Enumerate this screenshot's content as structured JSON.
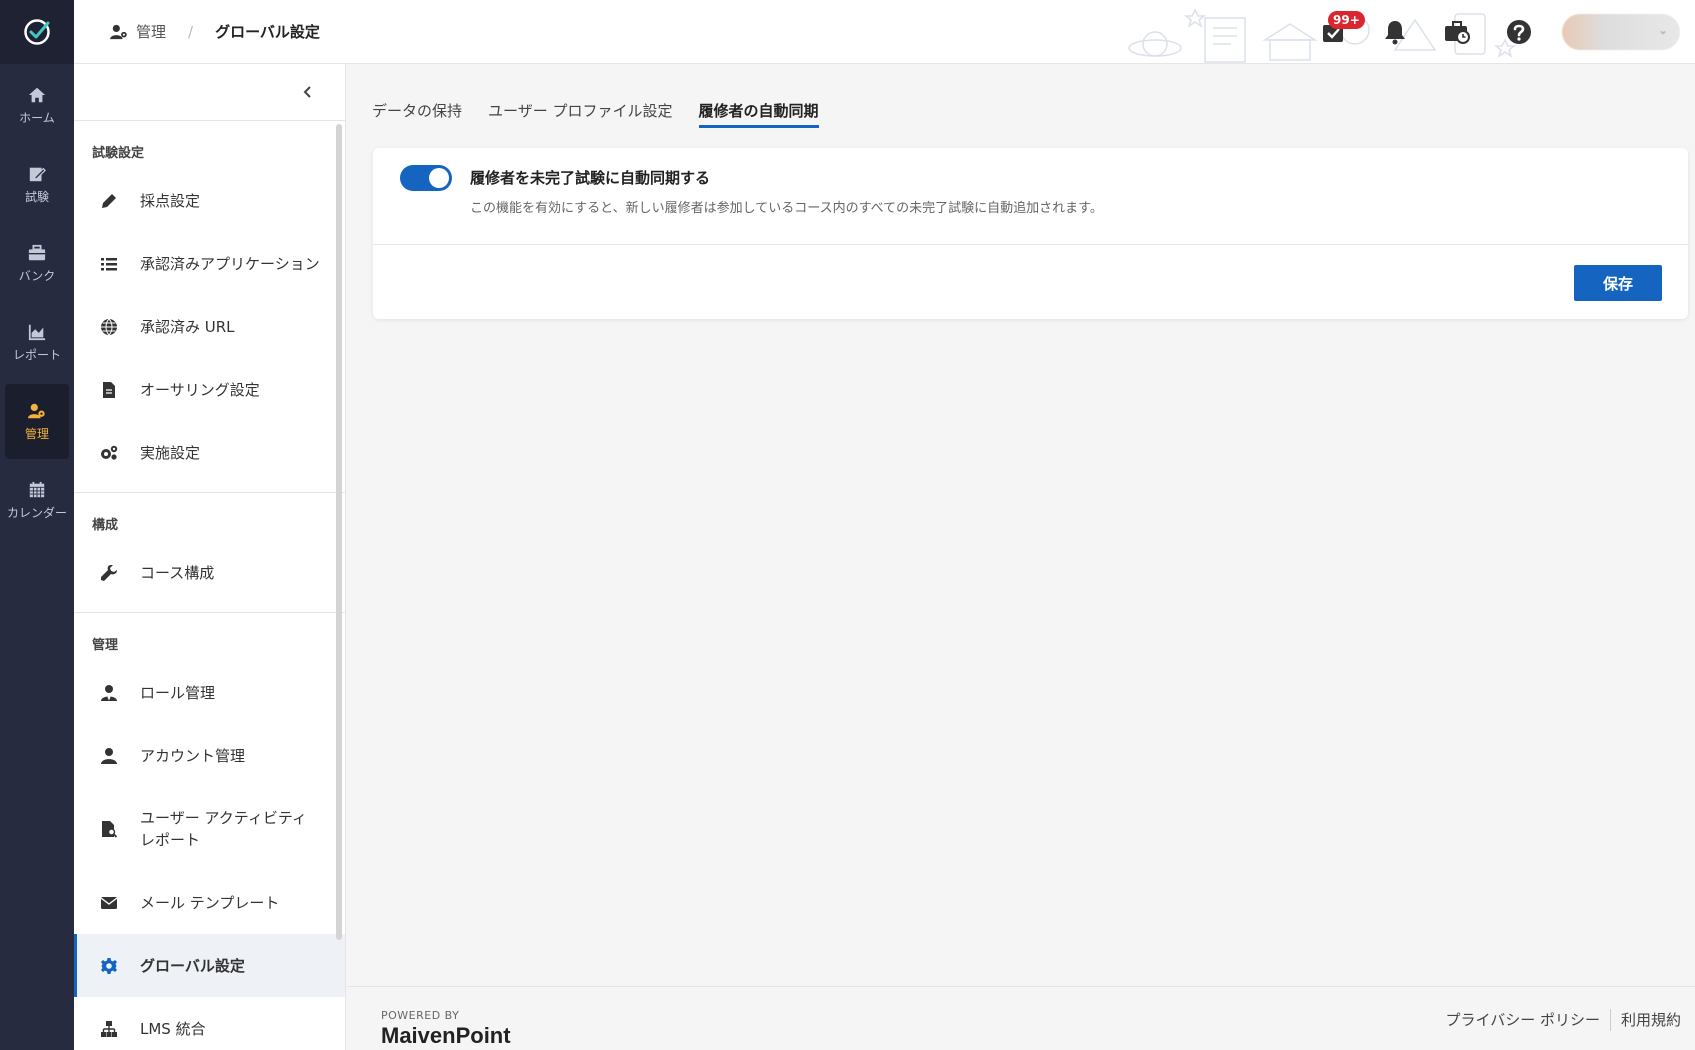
{
  "rail": {
    "items": [
      {
        "label": "ホーム",
        "icon": "home-icon"
      },
      {
        "label": "試験",
        "icon": "exam-icon"
      },
      {
        "label": "バンク",
        "icon": "bank-icon"
      },
      {
        "label": "レポート",
        "icon": "report-icon"
      },
      {
        "label": "管理",
        "icon": "admin-icon"
      },
      {
        "label": "カレンダー",
        "icon": "calendar-icon"
      }
    ],
    "active_index": 4
  },
  "breadcrumb": {
    "root": "管理",
    "separator": "/",
    "current": "グローバル設定"
  },
  "topbar": {
    "badge": "99+"
  },
  "sidebar": {
    "sections": [
      {
        "title": "試験設定",
        "items": [
          {
            "label": "採点設定",
            "icon": "pencil-icon"
          },
          {
            "label": "承認済みアプリケーション",
            "icon": "list-icon"
          },
          {
            "label": "承認済み URL",
            "icon": "globe-icon"
          },
          {
            "label": "オーサリング設定",
            "icon": "document-icon"
          },
          {
            "label": "実施設定",
            "icon": "gears-icon"
          }
        ]
      },
      {
        "title": "構成",
        "items": [
          {
            "label": "コース構成",
            "icon": "wrench-icon"
          }
        ]
      },
      {
        "title": "管理",
        "items": [
          {
            "label": "ロール管理",
            "icon": "user-tie-icon"
          },
          {
            "label": "アカウント管理",
            "icon": "user-icon"
          },
          {
            "label": "ユーザー アクティビティ レポート",
            "icon": "file-search-icon"
          },
          {
            "label": "メール テンプレート",
            "icon": "envelope-icon"
          },
          {
            "label": "グローバル設定",
            "icon": "gear-icon"
          },
          {
            "label": "LMS 統合",
            "icon": "sitemap-icon"
          }
        ]
      }
    ]
  },
  "tabs": [
    {
      "label": "データの保持"
    },
    {
      "label": "ユーザー プロファイル設定"
    },
    {
      "label": "履修者の自動同期"
    }
  ],
  "active_tab": 2,
  "option": {
    "title": "履修者を未完了試験に自動同期する",
    "description": "この機能を有効にすると、新しい履修者は参加しているコース内のすべての未完了試験に自動追加されます。",
    "enabled": true
  },
  "save_label": "保存",
  "footer": {
    "powered_by": "POWERED BY",
    "brand": "MaivenPoint",
    "links": [
      "プライバシー ポリシー",
      "利用規約"
    ]
  },
  "colors": {
    "accent": "#1565c0",
    "rail_bg": "#272b3f",
    "rail_active": "#f3b23c",
    "badge": "#d9262f"
  }
}
